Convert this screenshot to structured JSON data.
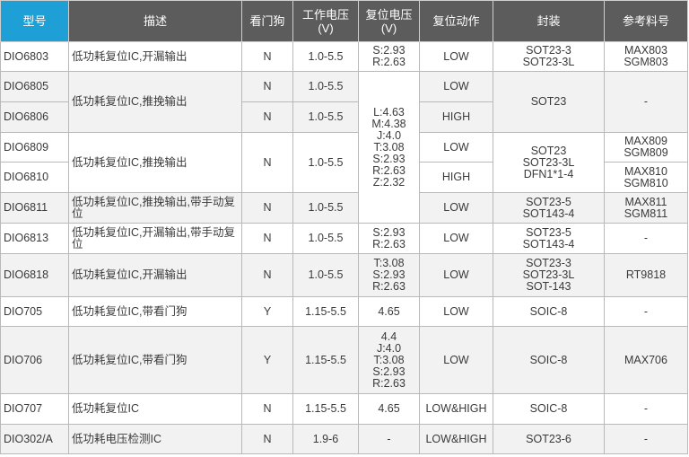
{
  "headers": {
    "model": "型号",
    "desc": "描述",
    "watchdog": "看门狗",
    "voltage": "工作电压\n(V)",
    "reset_voltage": "复位电压\n(V)",
    "reset_action": "复位动作",
    "package": "封装",
    "ref": "参考料号"
  },
  "rows": {
    "r1": {
      "model": "DIO6803",
      "desc": "低功耗复位IC,开漏输出",
      "wd": "N",
      "volt": "1.0-5.5",
      "rv": "S:2.93\nR:2.63",
      "act": "LOW",
      "pkg": "SOT23-3\nSOT23-3L",
      "ref": "MAX803\nSGM803"
    },
    "r2": {
      "model": "DIO6805",
      "desc": "低功耗复位IC,推挽输出",
      "wd": "N",
      "volt": "1.0-5.5",
      "act": "LOW",
      "pkg": "SOT23",
      "ref": "-"
    },
    "r3": {
      "model": "DIO6806",
      "wd": "N",
      "volt": "1.0-5.5",
      "rv": "L:4.63\nM:4.38\nJ:4.0\nT:3.08\nS:2.93\nR:2.63\nZ:2.32",
      "act": "HIGH"
    },
    "r4": {
      "model": "DIO6809",
      "desc": "低功耗复位IC,推挽输出",
      "wd": "N",
      "volt": "1.0-5.5",
      "act": "LOW",
      "pkg": "SOT23\nSOT23-3L\nDFN1*1-4",
      "ref": "MAX809\nSGM809"
    },
    "r5": {
      "model": "DIO6810",
      "act": "HIGH",
      "ref": "MAX810\nSGM810"
    },
    "r6": {
      "model": "DIO6811",
      "desc": "低功耗复位IC,推挽输出,带手动复位",
      "wd": "N",
      "volt": "1.0-5.5",
      "act": "LOW",
      "pkg": "SOT23-5\nSOT143-4",
      "ref": "MAX811\nSGM811"
    },
    "r7": {
      "model": "DIO6813",
      "desc": "低功耗复位IC,开漏输出,带手动复位",
      "wd": "N",
      "volt": "1.0-5.5",
      "rv": "S:2.93\nR:2.63",
      "act": "LOW",
      "pkg": "SOT23-5\nSOT143-4",
      "ref": "-"
    },
    "r8": {
      "model": "DIO6818",
      "desc": "低功耗复位IC,开漏输出",
      "wd": "N",
      "volt": "1.0-5.5",
      "rv": "T:3.08\nS:2.93\nR:2.63",
      "act": "LOW",
      "pkg": "SOT23-3\nSOT23-3L\nSOT-143",
      "ref": "RT9818"
    },
    "r9": {
      "model": "DIO705",
      "desc": "低功耗复位IC,带看门狗",
      "wd": "Y",
      "volt": "1.15-5.5",
      "rv": "4.65",
      "act": "LOW",
      "pkg": "SOIC-8",
      "ref": "-"
    },
    "r10": {
      "model": "DIO706",
      "desc": "低功耗复位IC,带看门狗",
      "wd": "Y",
      "volt": "1.15-5.5",
      "rv": "4.4\nJ:4.0\nT:3.08\nS:2.93\nR:2.63",
      "act": "LOW",
      "pkg": "SOIC-8",
      "ref": "MAX706"
    },
    "r11": {
      "model": "DIO707",
      "desc": "低功耗复位IC",
      "wd": "N",
      "volt": "1.15-5.5",
      "rv": "4.65",
      "act": "LOW&HIGH",
      "pkg": "SOIC-8",
      "ref": "-"
    },
    "r12": {
      "model": "DIO302/A",
      "desc": "低功耗电压检测IC",
      "wd": "N",
      "volt": "1.9-6",
      "rv": "-",
      "act": "LOW&HIGH",
      "pkg": "SOT23-6",
      "ref": "-"
    }
  }
}
